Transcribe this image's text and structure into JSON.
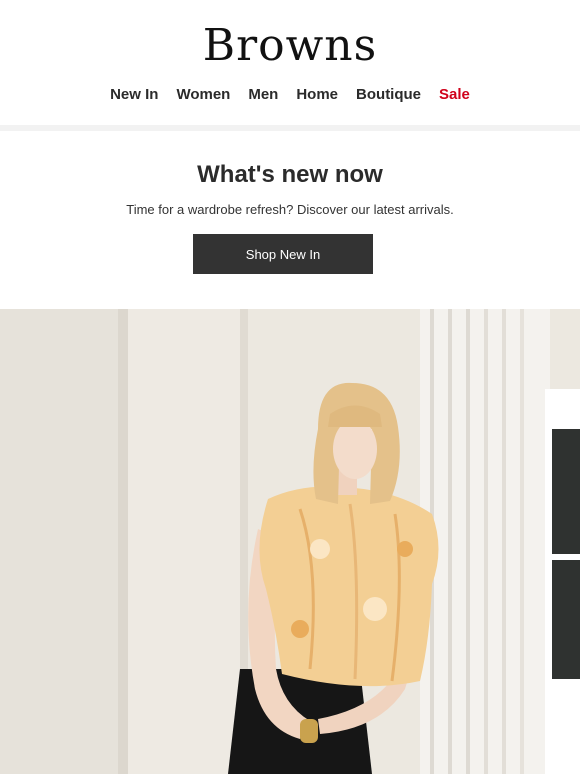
{
  "brand": {
    "logo_text": "Browns"
  },
  "nav": {
    "items": [
      {
        "label": "New In"
      },
      {
        "label": "Women"
      },
      {
        "label": "Men"
      },
      {
        "label": "Home"
      },
      {
        "label": "Boutique"
      },
      {
        "label": "Sale"
      }
    ],
    "sale_color": "#d0021b"
  },
  "hero": {
    "title": "What's new now",
    "subtitle": "Time for a wardrobe refresh? Discover our latest arrivals.",
    "cta_label": "Shop New In"
  },
  "image": {
    "subject": "model-photo"
  },
  "colors": {
    "cta_bg": "#333333",
    "text": "#2b2b2b"
  }
}
